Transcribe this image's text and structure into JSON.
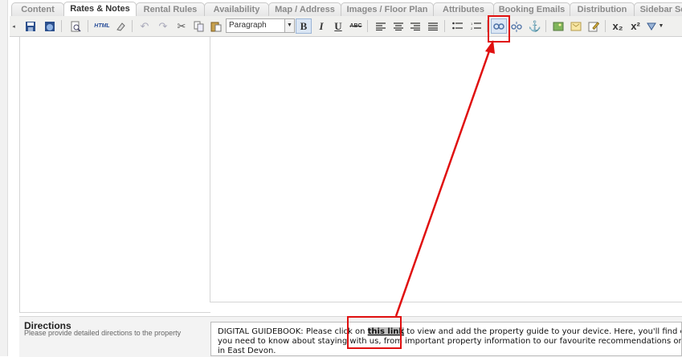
{
  "tabs": [
    {
      "label": "Content",
      "active": false
    },
    {
      "label": "Rates & Notes",
      "active": true
    },
    {
      "label": "Rental Rules",
      "active": false
    },
    {
      "label": "Availability",
      "active": false
    },
    {
      "label": "Map / Address",
      "active": false
    },
    {
      "label": "Images / Floor Plan",
      "active": false
    },
    {
      "label": "Attributes",
      "active": false
    },
    {
      "label": "Booking Emails",
      "active": false
    },
    {
      "label": "Distribution",
      "active": false
    },
    {
      "label": "Sidebar Se",
      "active": false
    }
  ],
  "toolbar": {
    "format_select_value": "Paragraph",
    "bold": "B",
    "italic": "I",
    "underline": "U",
    "strike": "ABC",
    "html": "HTML",
    "subscript": "x₂",
    "superscript": "x²"
  },
  "directions": {
    "title": "Directions",
    "help": "Please provide detailed directions to the property",
    "text_before": "DIGITAL GUIDEBOOK: Please click on ",
    "link_text": "this link",
    "text_after": " to view and add the property guide to your device. Here, you'll find everything",
    "line2": "you need to know about staying with us, from important property information to our favourite recommendations on where to vi",
    "line3": "in East Devon."
  },
  "colors": {
    "annotation": "#e01010",
    "active_button": "#dbe6f4"
  }
}
